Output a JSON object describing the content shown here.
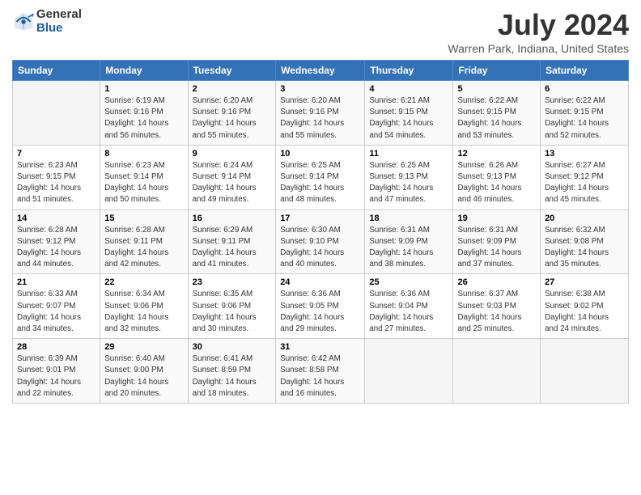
{
  "logo": {
    "general": "General",
    "blue": "Blue"
  },
  "title": "July 2024",
  "subtitle": "Warren Park, Indiana, United States",
  "days_of_week": [
    "Sunday",
    "Monday",
    "Tuesday",
    "Wednesday",
    "Thursday",
    "Friday",
    "Saturday"
  ],
  "weeks": [
    [
      {
        "day": "",
        "info": ""
      },
      {
        "day": "1",
        "info": "Sunrise: 6:19 AM\nSunset: 9:16 PM\nDaylight: 14 hours\nand 56 minutes."
      },
      {
        "day": "2",
        "info": "Sunrise: 6:20 AM\nSunset: 9:16 PM\nDaylight: 14 hours\nand 55 minutes."
      },
      {
        "day": "3",
        "info": "Sunrise: 6:20 AM\nSunset: 9:16 PM\nDaylight: 14 hours\nand 55 minutes."
      },
      {
        "day": "4",
        "info": "Sunrise: 6:21 AM\nSunset: 9:15 PM\nDaylight: 14 hours\nand 54 minutes."
      },
      {
        "day": "5",
        "info": "Sunrise: 6:22 AM\nSunset: 9:15 PM\nDaylight: 14 hours\nand 53 minutes."
      },
      {
        "day": "6",
        "info": "Sunrise: 6:22 AM\nSunset: 9:15 PM\nDaylight: 14 hours\nand 52 minutes."
      }
    ],
    [
      {
        "day": "7",
        "info": "Sunrise: 6:23 AM\nSunset: 9:15 PM\nDaylight: 14 hours\nand 51 minutes."
      },
      {
        "day": "8",
        "info": "Sunrise: 6:23 AM\nSunset: 9:14 PM\nDaylight: 14 hours\nand 50 minutes."
      },
      {
        "day": "9",
        "info": "Sunrise: 6:24 AM\nSunset: 9:14 PM\nDaylight: 14 hours\nand 49 minutes."
      },
      {
        "day": "10",
        "info": "Sunrise: 6:25 AM\nSunset: 9:14 PM\nDaylight: 14 hours\nand 48 minutes."
      },
      {
        "day": "11",
        "info": "Sunrise: 6:25 AM\nSunset: 9:13 PM\nDaylight: 14 hours\nand 47 minutes."
      },
      {
        "day": "12",
        "info": "Sunrise: 6:26 AM\nSunset: 9:13 PM\nDaylight: 14 hours\nand 46 minutes."
      },
      {
        "day": "13",
        "info": "Sunrise: 6:27 AM\nSunset: 9:12 PM\nDaylight: 14 hours\nand 45 minutes."
      }
    ],
    [
      {
        "day": "14",
        "info": "Sunrise: 6:28 AM\nSunset: 9:12 PM\nDaylight: 14 hours\nand 44 minutes."
      },
      {
        "day": "15",
        "info": "Sunrise: 6:28 AM\nSunset: 9:11 PM\nDaylight: 14 hours\nand 42 minutes."
      },
      {
        "day": "16",
        "info": "Sunrise: 6:29 AM\nSunset: 9:11 PM\nDaylight: 14 hours\nand 41 minutes."
      },
      {
        "day": "17",
        "info": "Sunrise: 6:30 AM\nSunset: 9:10 PM\nDaylight: 14 hours\nand 40 minutes."
      },
      {
        "day": "18",
        "info": "Sunrise: 6:31 AM\nSunset: 9:09 PM\nDaylight: 14 hours\nand 38 minutes."
      },
      {
        "day": "19",
        "info": "Sunrise: 6:31 AM\nSunset: 9:09 PM\nDaylight: 14 hours\nand 37 minutes."
      },
      {
        "day": "20",
        "info": "Sunrise: 6:32 AM\nSunset: 9:08 PM\nDaylight: 14 hours\nand 35 minutes."
      }
    ],
    [
      {
        "day": "21",
        "info": "Sunrise: 6:33 AM\nSunset: 9:07 PM\nDaylight: 14 hours\nand 34 minutes."
      },
      {
        "day": "22",
        "info": "Sunrise: 6:34 AM\nSunset: 9:06 PM\nDaylight: 14 hours\nand 32 minutes."
      },
      {
        "day": "23",
        "info": "Sunrise: 6:35 AM\nSunset: 9:06 PM\nDaylight: 14 hours\nand 30 minutes."
      },
      {
        "day": "24",
        "info": "Sunrise: 6:36 AM\nSunset: 9:05 PM\nDaylight: 14 hours\nand 29 minutes."
      },
      {
        "day": "25",
        "info": "Sunrise: 6:36 AM\nSunset: 9:04 PM\nDaylight: 14 hours\nand 27 minutes."
      },
      {
        "day": "26",
        "info": "Sunrise: 6:37 AM\nSunset: 9:03 PM\nDaylight: 14 hours\nand 25 minutes."
      },
      {
        "day": "27",
        "info": "Sunrise: 6:38 AM\nSunset: 9:02 PM\nDaylight: 14 hours\nand 24 minutes."
      }
    ],
    [
      {
        "day": "28",
        "info": "Sunrise: 6:39 AM\nSunset: 9:01 PM\nDaylight: 14 hours\nand 22 minutes."
      },
      {
        "day": "29",
        "info": "Sunrise: 6:40 AM\nSunset: 9:00 PM\nDaylight: 14 hours\nand 20 minutes."
      },
      {
        "day": "30",
        "info": "Sunrise: 6:41 AM\nSunset: 8:59 PM\nDaylight: 14 hours\nand 18 minutes."
      },
      {
        "day": "31",
        "info": "Sunrise: 6:42 AM\nSunset: 8:58 PM\nDaylight: 14 hours\nand 16 minutes."
      },
      {
        "day": "",
        "info": ""
      },
      {
        "day": "",
        "info": ""
      },
      {
        "day": "",
        "info": ""
      }
    ]
  ]
}
